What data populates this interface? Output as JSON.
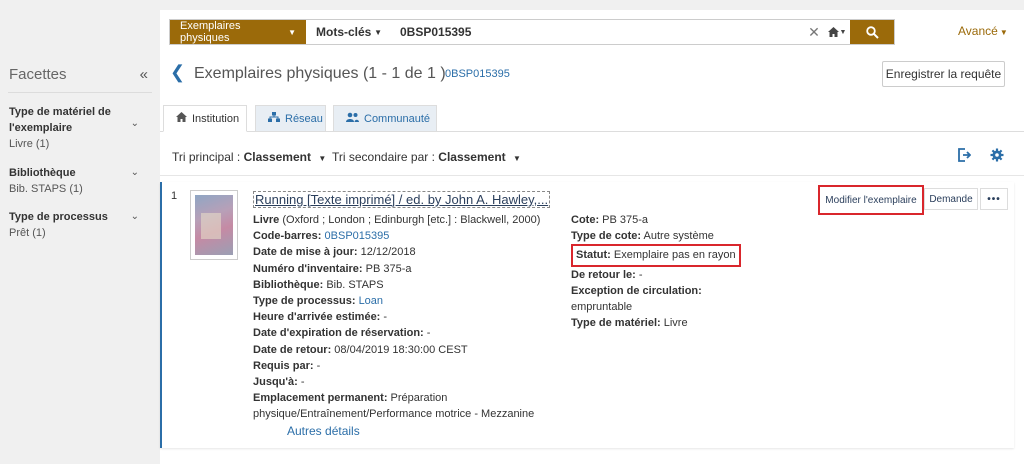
{
  "facets": {
    "title": "Facettes",
    "groups": [
      {
        "title": "Type de matériel de l'exemplaire",
        "value": "Livre (1)"
      },
      {
        "title": "Bibliothèque",
        "value": "Bib. STAPS (1)"
      },
      {
        "title": "Type de processus",
        "value": "Prêt (1)"
      }
    ]
  },
  "search": {
    "scope": "Exemplaires physiques",
    "field": "Mots-clés",
    "query": "0BSP015395",
    "advanced": "Avancé"
  },
  "header": {
    "title": "Exemplaires physiques (1 - 1 de 1 )",
    "barcode": "0BSP015395",
    "save_query": "Enregistrer la requête"
  },
  "tabs": [
    {
      "label": "Institution",
      "icon": "home-icon"
    },
    {
      "label": "Réseau",
      "icon": "network-icon"
    },
    {
      "label": "Communauté",
      "icon": "users-icon"
    }
  ],
  "sort": {
    "primary_label": "Tri principal :",
    "primary_value": "Classement",
    "secondary_label": "Tri secondaire par :",
    "secondary_value": "Classement"
  },
  "result": {
    "number": "1",
    "title": "Running [Texte imprimé] / ed. by John A. Hawley,...",
    "left_fields": [
      {
        "key": "Livre",
        "value": " (Oxford ; London ; Edinburgh [etc.] : Blackwell, 2000)"
      },
      {
        "key": "Code-barres:",
        "value": "0BSP015395",
        "link": true
      },
      {
        "key": "Date de mise à jour:",
        "value": " 12/12/2018"
      },
      {
        "key": "Numéro d'inventaire:",
        "value": " PB 375-a"
      },
      {
        "key": "Bibliothèque:",
        "value": " Bib. STAPS"
      },
      {
        "key": "Type de processus:",
        "value": "Loan",
        "link": true
      },
      {
        "key": "Heure d'arrivée estimée:",
        "value": " -"
      },
      {
        "key": "Date d'expiration de réservation:",
        "value": " -"
      },
      {
        "key": "Date de retour:",
        "value": " 08/04/2019 18:30:00 CEST"
      },
      {
        "key": "Requis par:",
        "value": " -"
      },
      {
        "key": "Jusqu'à:",
        "value": " -"
      },
      {
        "key": "Emplacement permanent:",
        "value": " Préparation physique/Entraînement/Performance motrice - Mezzanine"
      }
    ],
    "right_fields": [
      {
        "key": "Cote:",
        "value": " PB 375-a"
      },
      {
        "key": "Type de cote:",
        "value": " Autre système"
      },
      {
        "key": "Statut:",
        "value": " Exemplaire pas en rayon"
      },
      {
        "key": "De retour le:",
        "value": " -"
      },
      {
        "key": "Exception de circulation:",
        "value": "empruntable"
      },
      {
        "key": "Type de matériel:",
        "value": " Livre"
      }
    ],
    "more_details": "Autres détails",
    "actions": {
      "edit": "Modifier l'exemplaire",
      "request": "Demande",
      "more": "•••"
    }
  },
  "colors": {
    "brand": "#9b6a0a",
    "link": "#2b6ea8",
    "highlight": "#d9262c"
  }
}
